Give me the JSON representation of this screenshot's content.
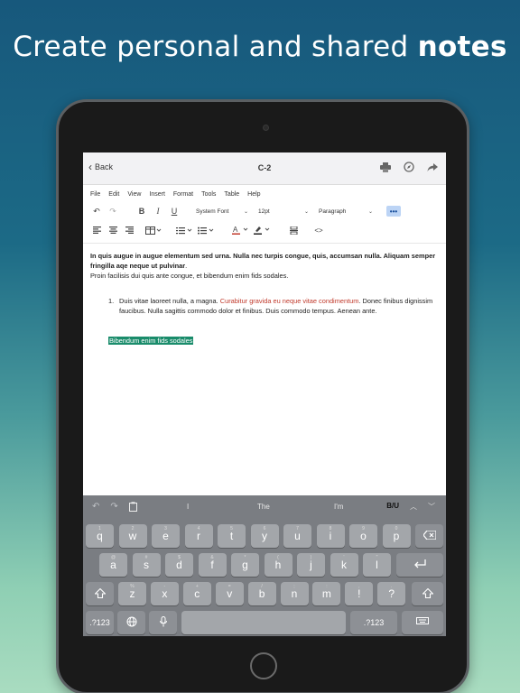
{
  "headline": {
    "normal": "Create personal and shared ",
    "bold": "notes"
  },
  "nav": {
    "back": "Back",
    "title": "C-2"
  },
  "menu": [
    "File",
    "Edit",
    "View",
    "Insert",
    "Format",
    "Tools",
    "Table",
    "Help"
  ],
  "toolbar": {
    "font": "System Font",
    "size": "12pt",
    "block": "Paragraph",
    "more": "•••",
    "code": "<>"
  },
  "doc": {
    "p1_bold": "In quis augue in augue elementum sed urna. Nulla nec turpis congue, quis, accumsan nulla. Aliquam semper fringilla aqe neque ut pulvinar",
    "p1_period": ".",
    "p2": "Proin facilisis dui quis ante congue, et bibendum enim fids sodales.",
    "list_num": "1.",
    "list_a": "Duis vitae laoreet nulla, a magna. ",
    "list_red": "Curabitur gravida eu neque vitae condimentum",
    "list_b": ". Donec finibus dignissim faucibus. Nulla sagittis commodo dolor et finibus. Duis  commodo tempus. Aenean ante.",
    "highlight": "Bibendum enim fids sodales"
  },
  "keyboard": {
    "suggestions": [
      "I",
      "The",
      "I'm"
    ],
    "biu": "B/U",
    "row1": [
      {
        "k": "q",
        "s": "1"
      },
      {
        "k": "w",
        "s": "2"
      },
      {
        "k": "e",
        "s": "3"
      },
      {
        "k": "r",
        "s": "4"
      },
      {
        "k": "t",
        "s": "5"
      },
      {
        "k": "y",
        "s": "6"
      },
      {
        "k": "u",
        "s": "7"
      },
      {
        "k": "i",
        "s": "8"
      },
      {
        "k": "o",
        "s": "9"
      },
      {
        "k": "p",
        "s": "0"
      }
    ],
    "row2": [
      {
        "k": "a",
        "s": "@"
      },
      {
        "k": "s",
        "s": "#"
      },
      {
        "k": "d",
        "s": "$"
      },
      {
        "k": "f",
        "s": "&"
      },
      {
        "k": "g",
        "s": "*"
      },
      {
        "k": "h",
        "s": "("
      },
      {
        "k": "j",
        "s": ")"
      },
      {
        "k": "k",
        "s": "'"
      },
      {
        "k": "l",
        "s": "\""
      }
    ],
    "row3": [
      {
        "k": "z",
        "s": "%"
      },
      {
        "k": "x",
        "s": "-"
      },
      {
        "k": "c",
        "s": "+"
      },
      {
        "k": "v",
        "s": "="
      },
      {
        "k": "b",
        "s": "/"
      },
      {
        "k": "n",
        "s": ";"
      },
      {
        "k": "m",
        "s": ":"
      },
      {
        "k": "!",
        "s": ","
      },
      {
        "k": "?",
        "s": "."
      }
    ],
    "num_left": ".?123",
    "num_right": ".?123"
  }
}
